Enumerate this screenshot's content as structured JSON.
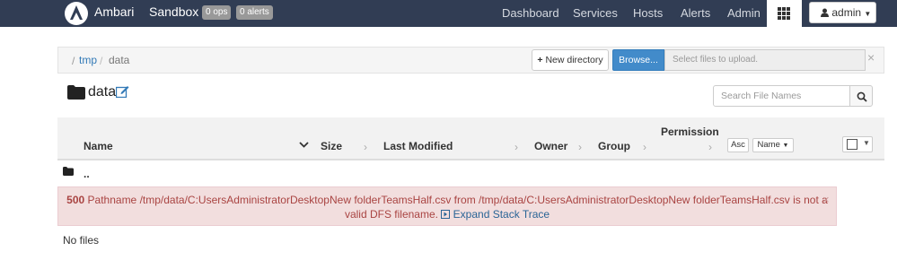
{
  "navbar": {
    "brand": "Ambari",
    "cluster": "Sandbox",
    "ops_badge": "0 ops",
    "alerts_badge": "0 alerts",
    "links": [
      "Dashboard",
      "Services",
      "Hosts",
      "Alerts",
      "Admin"
    ],
    "user": "admin",
    "bg_color": "#313d54"
  },
  "breadcrumb": {
    "root": "/",
    "items": [
      "tmp",
      "data"
    ]
  },
  "toolbar": {
    "new_directory": "New directory",
    "browse": "Browse...",
    "upload_placeholder": "Select files to upload."
  },
  "page": {
    "title": "data",
    "search_placeholder": "Search File Names"
  },
  "table": {
    "columns": [
      "Name",
      "Size",
      "Last Modified",
      "Owner",
      "Group",
      "Permission"
    ],
    "sort_order": "Asc",
    "sort_field": "Name",
    "parent_row": ".."
  },
  "alert": {
    "code": "500",
    "message": "Pathname /tmp/data/C:UsersAdministratorDesktopNew folderTeamsHalf.csv from /tmp/data/C:UsersAdministratorDesktopNew folderTeamsHalf.csv is not a valid DFS filename.",
    "expand": "Expand Stack Trace"
  },
  "empty_text": "No files",
  "icons": {
    "logo": "ambari-logo-icon",
    "apps": "grid-icon",
    "user": "user-icon",
    "folder": "folder-icon",
    "edit": "edit-icon",
    "search": "search-icon"
  }
}
